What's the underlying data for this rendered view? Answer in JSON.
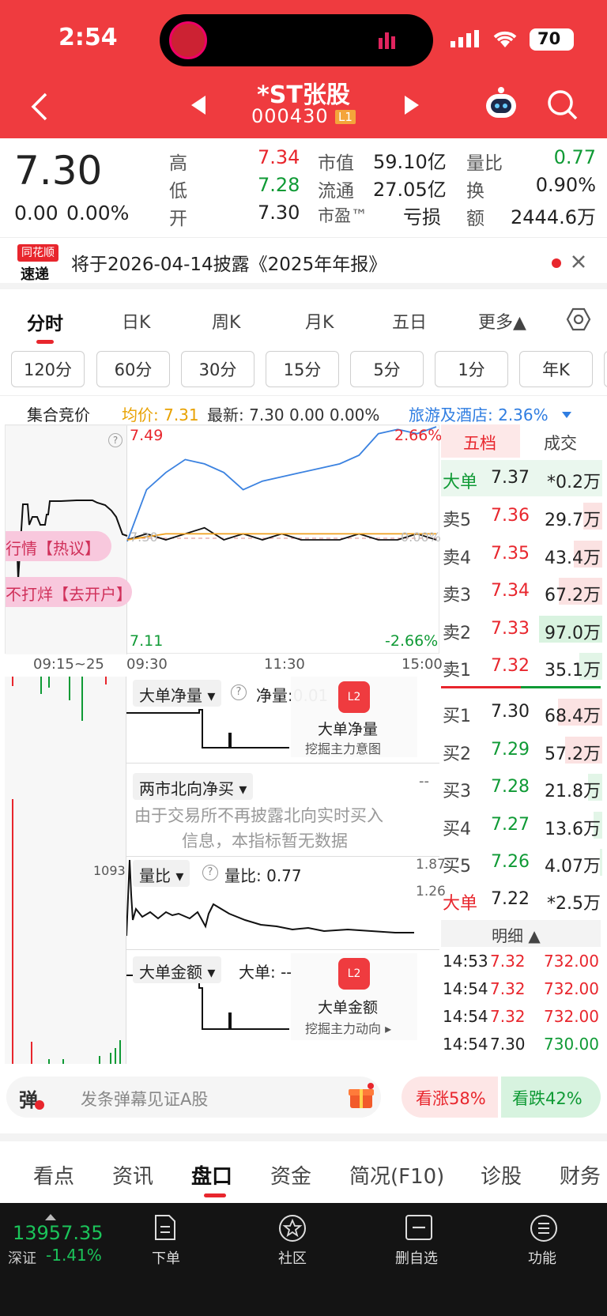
{
  "status": {
    "time": "2:54",
    "battery": "70"
  },
  "nav": {
    "title": "*ST张股",
    "code": "000430",
    "level": "L1"
  },
  "quote": {
    "price": "7.30",
    "change": "0.00",
    "pct": "0.00%",
    "high_label": "高",
    "high": "7.34",
    "low_label": "低",
    "low": "7.28",
    "open_label": "开",
    "open": "7.30",
    "mktcap_label": "市值",
    "mktcap": "59.10亿",
    "float_label": "流通",
    "float": "27.05亿",
    "pe_label": "市盈™",
    "pe": "亏损",
    "volratio_label": "量比",
    "volratio": "0.77",
    "turnover_label": "换",
    "turnover": "0.90%",
    "amount_label": "额",
    "amount": "2444.6万"
  },
  "notice": {
    "logo_top": "同花顺",
    "logo_bottom": "速递",
    "text": "将于2026-04-14披露《2025年年报》"
  },
  "tabs": [
    {
      "label": "分时",
      "active": true
    },
    {
      "label": "日K"
    },
    {
      "label": "周K"
    },
    {
      "label": "月K"
    },
    {
      "label": "五日"
    },
    {
      "label": "更多▲"
    }
  ],
  "periods": [
    "120分",
    "60分",
    "30分",
    "15分",
    "5分",
    "1分",
    "年K"
  ],
  "info_bar": {
    "auction": "集合竞价",
    "avg": "均价: 7.31",
    "latest": "最新: 7.30  0.00  0.00%",
    "sector": "旅游及酒店: 2.36%"
  },
  "chart": {
    "max_label": "7.49",
    "min_label": "7.11",
    "max_pct": "2.66%",
    "min_pct": "-2.66%",
    "mid_label": "7.30",
    "mid_pct": "0.00%",
    "time_labels": [
      "09:15~25",
      "09:30",
      "11:30",
      "15:00"
    ],
    "ads": [
      "行情【热议】",
      "不打烊【去开户】"
    ]
  },
  "chart_data": {
    "type": "line",
    "x_range": [
      "09:30",
      "15:00"
    ],
    "ylim": [
      7.11,
      7.49
    ],
    "series": [
      {
        "values": [
          7.3,
          7.31,
          7.3,
          7.31,
          7.32,
          7.3,
          7.31,
          7.3,
          7.31,
          7.3,
          7.3,
          7.3,
          7.31,
          7.3,
          7.3,
          7.31,
          7.3
        ]
      },
      {
        "values": [
          7.3,
          7.305,
          7.31,
          7.31,
          7.31,
          7.31,
          7.31,
          7.31,
          7.31,
          7.31,
          7.31,
          7.31,
          7.31,
          7.31,
          7.31,
          7.31,
          7.31
        ]
      }
    ],
    "sector_pct": [
      0.0,
      1.2,
      1.6,
      1.9,
      1.8,
      1.6,
      1.2,
      1.4,
      1.5,
      1.6,
      1.7,
      1.8,
      2.0,
      2.5,
      2.6,
      2.5,
      2.66
    ],
    "volume_peak": "1093"
  },
  "orderbook": {
    "tab_five": "五档",
    "tab_deal": "成交",
    "top_big": {
      "label": "大单",
      "price": "7.37",
      "vol": "*0.2万"
    },
    "sells": [
      {
        "label": "卖5",
        "price": "7.36",
        "vol": "29.7万",
        "ratio": 0.3
      },
      {
        "label": "卖4",
        "price": "7.35",
        "vol": "43.4万",
        "ratio": 0.45
      },
      {
        "label": "卖3",
        "price": "7.34",
        "vol": "67.2万",
        "ratio": 0.69
      },
      {
        "label": "卖2",
        "price": "7.33",
        "vol": "97.0万",
        "ratio": 1.0
      },
      {
        "label": "卖1",
        "price": "7.32",
        "vol": "35.1万",
        "ratio": 0.36
      }
    ],
    "buys": [
      {
        "label": "买1",
        "price": "7.30",
        "vol": "68.4万",
        "ratio": 0.7
      },
      {
        "label": "买2",
        "price": "7.29",
        "vol": "57.2万",
        "ratio": 0.59
      },
      {
        "label": "买3",
        "price": "7.28",
        "vol": "21.8万",
        "ratio": 0.22
      },
      {
        "label": "买4",
        "price": "7.27",
        "vol": "13.6万",
        "ratio": 0.14
      },
      {
        "label": "买5",
        "price": "7.26",
        "vol": "4.07万",
        "ratio": 0.04
      }
    ],
    "bottom_big": {
      "label": "大单",
      "price": "7.22",
      "vol": "*2.5万"
    },
    "detail_label": "明细 ▲",
    "ticks": [
      {
        "time": "14:53",
        "price": "7.32",
        "vol": "732.00"
      },
      {
        "time": "14:54",
        "price": "7.32",
        "vol": "732.00"
      },
      {
        "time": "14:54",
        "price": "7.32",
        "vol": "732.00"
      },
      {
        "time": "14:54",
        "price": "7.30",
        "vol": "730.00"
      }
    ]
  },
  "indicators": {
    "big_net": {
      "title": "大单净量 ▾",
      "value": "净量:0.01",
      "promo_title": "大单净量",
      "promo_sub": "挖掘主力意图"
    },
    "north": {
      "title": "两市北向净买 ▾",
      "msg1": "由于交易所不再披露北向实时买入",
      "msg2": "信息，本指标暂无数据",
      "dash": "--"
    },
    "vol_ratio": {
      "title": "量比 ▾",
      "value": "量比: 0.77",
      "top": "1.87",
      "mid": "1.26"
    },
    "big_amt": {
      "title": "大单金额 ▾",
      "value": "大单: --",
      "promo_title": "大单金额",
      "promo_sub": "挖掘主力动向 ▸"
    }
  },
  "danmaku": {
    "icon": "弹",
    "placeholder": "发条弹幕见证A股",
    "up": "看涨58%",
    "down": "看跌42%"
  },
  "bottom_tabs": [
    "看点",
    "资讯",
    "盘口",
    "资金",
    "简况(F10)",
    "诊股",
    "财务"
  ],
  "dock": {
    "index_value": "13957.35",
    "index_name": "深证",
    "index_pct": "-1.41%",
    "items": [
      "下单",
      "社区",
      "删自选",
      "功能"
    ]
  }
}
